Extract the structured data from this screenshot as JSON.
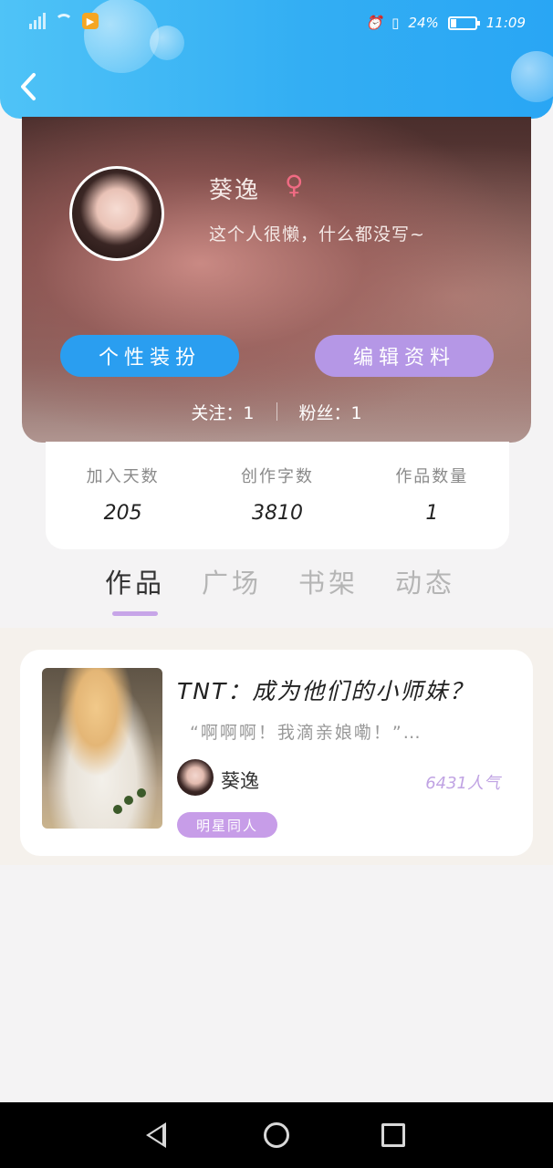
{
  "status_bar": {
    "battery_percent": "24%",
    "time": "11:09",
    "app_badge": "▶"
  },
  "header": {
    "back_icon": "chevron-left-icon"
  },
  "profile": {
    "name": "葵逸",
    "gender_symbol": "♀",
    "bio": "这个人很懒，什么都没写~",
    "buttons": {
      "dress_up": "个性装扮",
      "edit_profile": "编辑资料"
    },
    "following_label": "关注：1",
    "followers_label": "粉丝：1"
  },
  "stats": [
    {
      "label": "加入天数",
      "value": "205"
    },
    {
      "label": "创作字数",
      "value": "3810"
    },
    {
      "label": "作品数量",
      "value": "1"
    }
  ],
  "tabs": [
    {
      "label": "作品",
      "active": true
    },
    {
      "label": "广场",
      "active": false
    },
    {
      "label": "书架",
      "active": false
    },
    {
      "label": "动态",
      "active": false
    }
  ],
  "works": [
    {
      "title": "TNT：成为他们的小师妹？",
      "excerpt": "“啊啊啊！我滴亲娘嘞！”…",
      "author": "葵逸",
      "popularity": "6431人气",
      "tag": "明星同人"
    }
  ],
  "colors": {
    "header_blue": "#33aef3",
    "button_blue": "#2a9ef0",
    "button_purple": "#b597e6",
    "accent_purple": "#c7a5e8",
    "gender_pink": "#f06b83"
  }
}
